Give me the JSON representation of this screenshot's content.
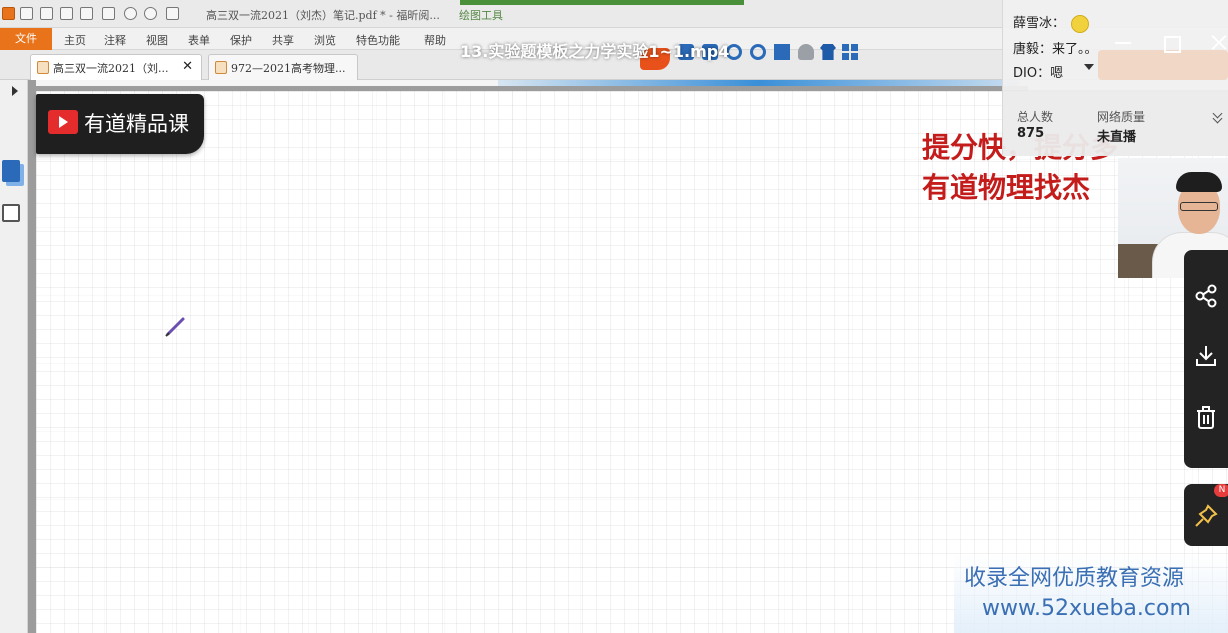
{
  "pdf_app": {
    "document_title": "高三双一流2021（刘杰）笔记.pdf * - 福昕阅...",
    "tool_tab": "绘图工具",
    "menu": {
      "file": "文件",
      "items": [
        "主页",
        "注释",
        "视图",
        "表单",
        "保护",
        "共享",
        "浏览",
        "特色功能",
        "帮助"
      ]
    },
    "tabs": [
      {
        "label": "高三双一流2021（刘...",
        "active": true
      },
      {
        "label": "972—2021高考物理...",
        "active": false
      }
    ]
  },
  "video": {
    "title": "13.实验题模板之力学实验1~1.mp4"
  },
  "brand": {
    "name": "有道精品课"
  },
  "slogan": {
    "line1": "提分快，提分多",
    "line2": "有道物理找杰"
  },
  "chat": {
    "messages": [
      {
        "user": "薛雪冰",
        "text": ""
      },
      {
        "user": "唐毅",
        "text": "来了。。"
      },
      {
        "user": "DIO",
        "text": "嗯"
      }
    ]
  },
  "stats": {
    "total_label": "总人数",
    "total_value": "875",
    "network_label": "网络质量",
    "network_value": "未直播"
  },
  "side_tools": {
    "badge": "N"
  },
  "watermark": {
    "line1": "收录全网优质教育资源",
    "line2": "www.52xueba.com"
  },
  "colors": {
    "brand_red": "#e52c2c",
    "slogan_red": "#c41b1b",
    "file_menu_orange": "#e8731a",
    "watermark_blue": "#3a6fb4"
  },
  "icons": [
    "minimize-icon",
    "maximize-icon",
    "close-icon",
    "share-icon",
    "download-icon",
    "delete-icon",
    "pin-icon",
    "pen-icon",
    "emoji-icon"
  ]
}
